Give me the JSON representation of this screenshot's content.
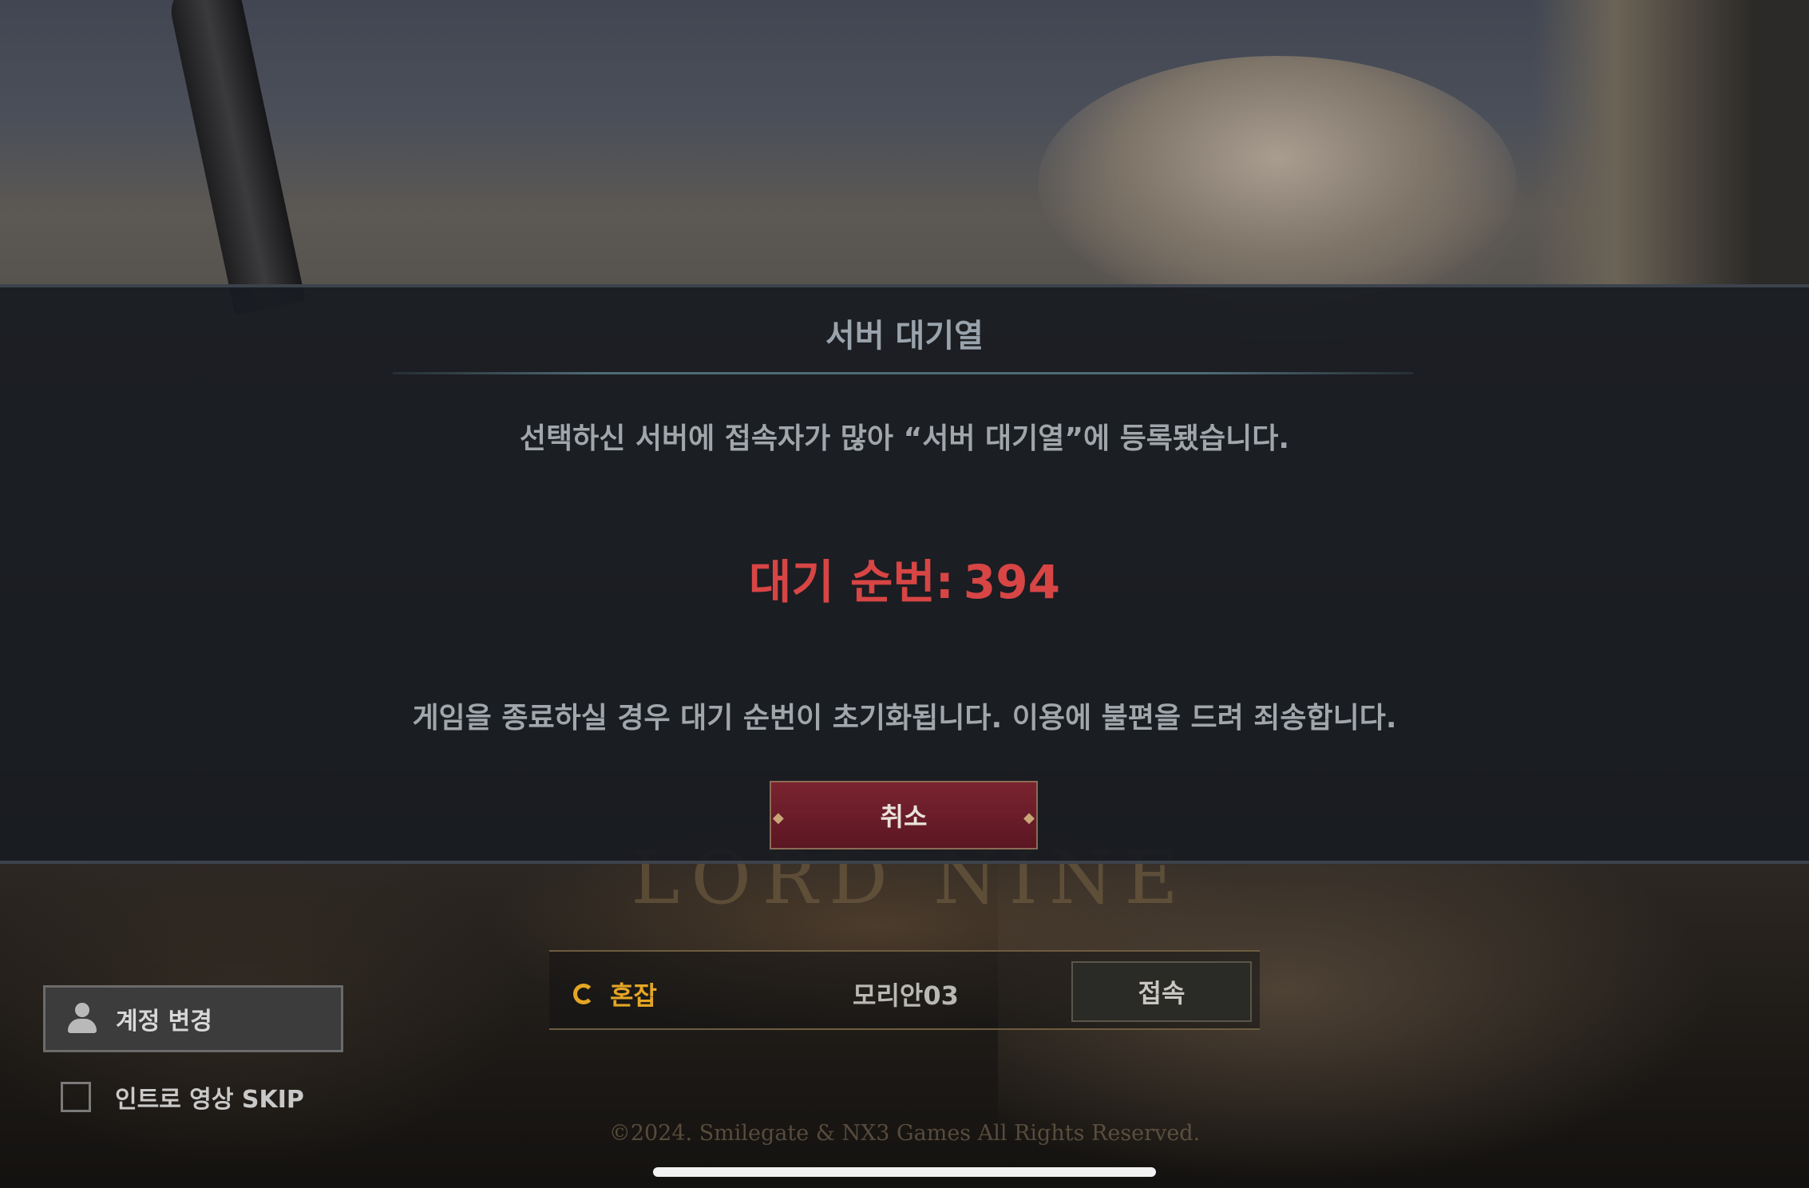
{
  "modal": {
    "title": "서버 대기열",
    "message": "선택하신 서버에 접속자가 많아 “서버 대기열”에 등록됐습니다.",
    "queue_label": "대기 순번:",
    "queue_number": "394",
    "note": "게임을 종료하실 경우 대기 순번이 초기화됩니다. 이용에 불편을 드려 죄송합니다.",
    "cancel_label": "취소"
  },
  "server": {
    "status_icon": "congestion-icon",
    "status_label": "혼잡",
    "name": "모리안03",
    "connect_label": "접속"
  },
  "account": {
    "icon": "user-icon",
    "label": "계정 변경"
  },
  "intro_skip": {
    "label": "인트로 영상 SKIP",
    "checked": false
  },
  "footer": {
    "copyright": "©2024. Smilegate & NX3 Games All Rights Reserved."
  },
  "colors": {
    "queue_number": "#d74545",
    "status_congested": "#e4a624",
    "cancel_button": "#6b1c28"
  }
}
